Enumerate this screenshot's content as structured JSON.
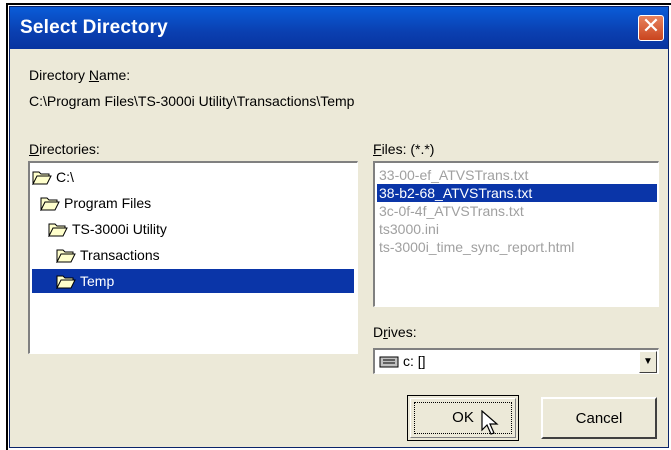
{
  "window": {
    "title": "Select Directory"
  },
  "directory_name": {
    "label_prefix": "Directory ",
    "label_mnemonic": "N",
    "label_suffix": "ame:",
    "path": "C:\\Program Files\\TS-3000i Utility\\Transactions\\Temp"
  },
  "directories": {
    "label_mnemonic": "D",
    "label_suffix": "irectories:",
    "items": [
      {
        "label": "C:\\",
        "selected": false
      },
      {
        "label": "Program Files",
        "selected": false
      },
      {
        "label": "TS-3000i Utility",
        "selected": false
      },
      {
        "label": "Transactions",
        "selected": false
      },
      {
        "label": "Temp",
        "selected": true
      }
    ]
  },
  "files": {
    "label_mnemonic": "F",
    "label_suffix": "iles: (*.*)",
    "items": [
      {
        "label": "33-00-ef_ATVSTrans.txt",
        "selected": false
      },
      {
        "label": "38-b2-68_ATVSTrans.txt",
        "selected": true
      },
      {
        "label": "3c-0f-4f_ATVSTrans.txt",
        "selected": false
      },
      {
        "label": "ts3000.ini",
        "selected": false
      },
      {
        "label": "ts-3000i_time_sync_report.html",
        "selected": false
      }
    ]
  },
  "drives": {
    "label_prefix": "D",
    "label_mnemonic": "r",
    "label_suffix": "ives:",
    "selected": "c: []"
  },
  "buttons": {
    "ok": "OK",
    "cancel": "Cancel"
  },
  "colors": {
    "title_bar": "#0a3fb0",
    "selection": "#0a35a8",
    "dialog_bg": "#ece9d8"
  }
}
